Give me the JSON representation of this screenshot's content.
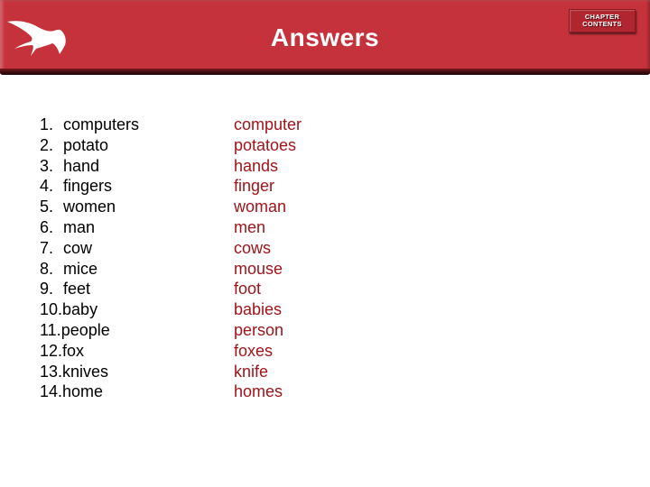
{
  "header": {
    "title": "Answers",
    "logo_icon": "bird-logo-icon",
    "chapter_button": {
      "line1": "CHAPTER",
      "line2": "CONTENTS"
    }
  },
  "colors": {
    "header_bg": "#c6323c",
    "answer_text": "#a0141a",
    "question_text": "#000000"
  },
  "questions": [
    {
      "num": "1.",
      "word": "computers"
    },
    {
      "num": "2.",
      "word": "potato"
    },
    {
      "num": "3.",
      "word": "hand"
    },
    {
      "num": "4.",
      "word": "fingers"
    },
    {
      "num": "5.",
      "word": "women"
    },
    {
      "num": "6.",
      "word": "man"
    },
    {
      "num": "7.",
      "word": "cow"
    },
    {
      "num": "8.",
      "word": "mice"
    },
    {
      "num": "9.",
      "word": "feet"
    },
    {
      "num": "10.",
      "word": "baby"
    },
    {
      "num": "11.",
      "word": "people"
    },
    {
      "num": "12.",
      "word": "fox"
    },
    {
      "num": "13.",
      "word": "knives"
    },
    {
      "num": "14.",
      "word": "home"
    }
  ],
  "answers": [
    "computer",
    "potatoes",
    "hands",
    "finger",
    "woman",
    "men",
    "cows",
    "mouse",
    "foot",
    "babies",
    "person",
    "foxes",
    "knife",
    "homes"
  ]
}
